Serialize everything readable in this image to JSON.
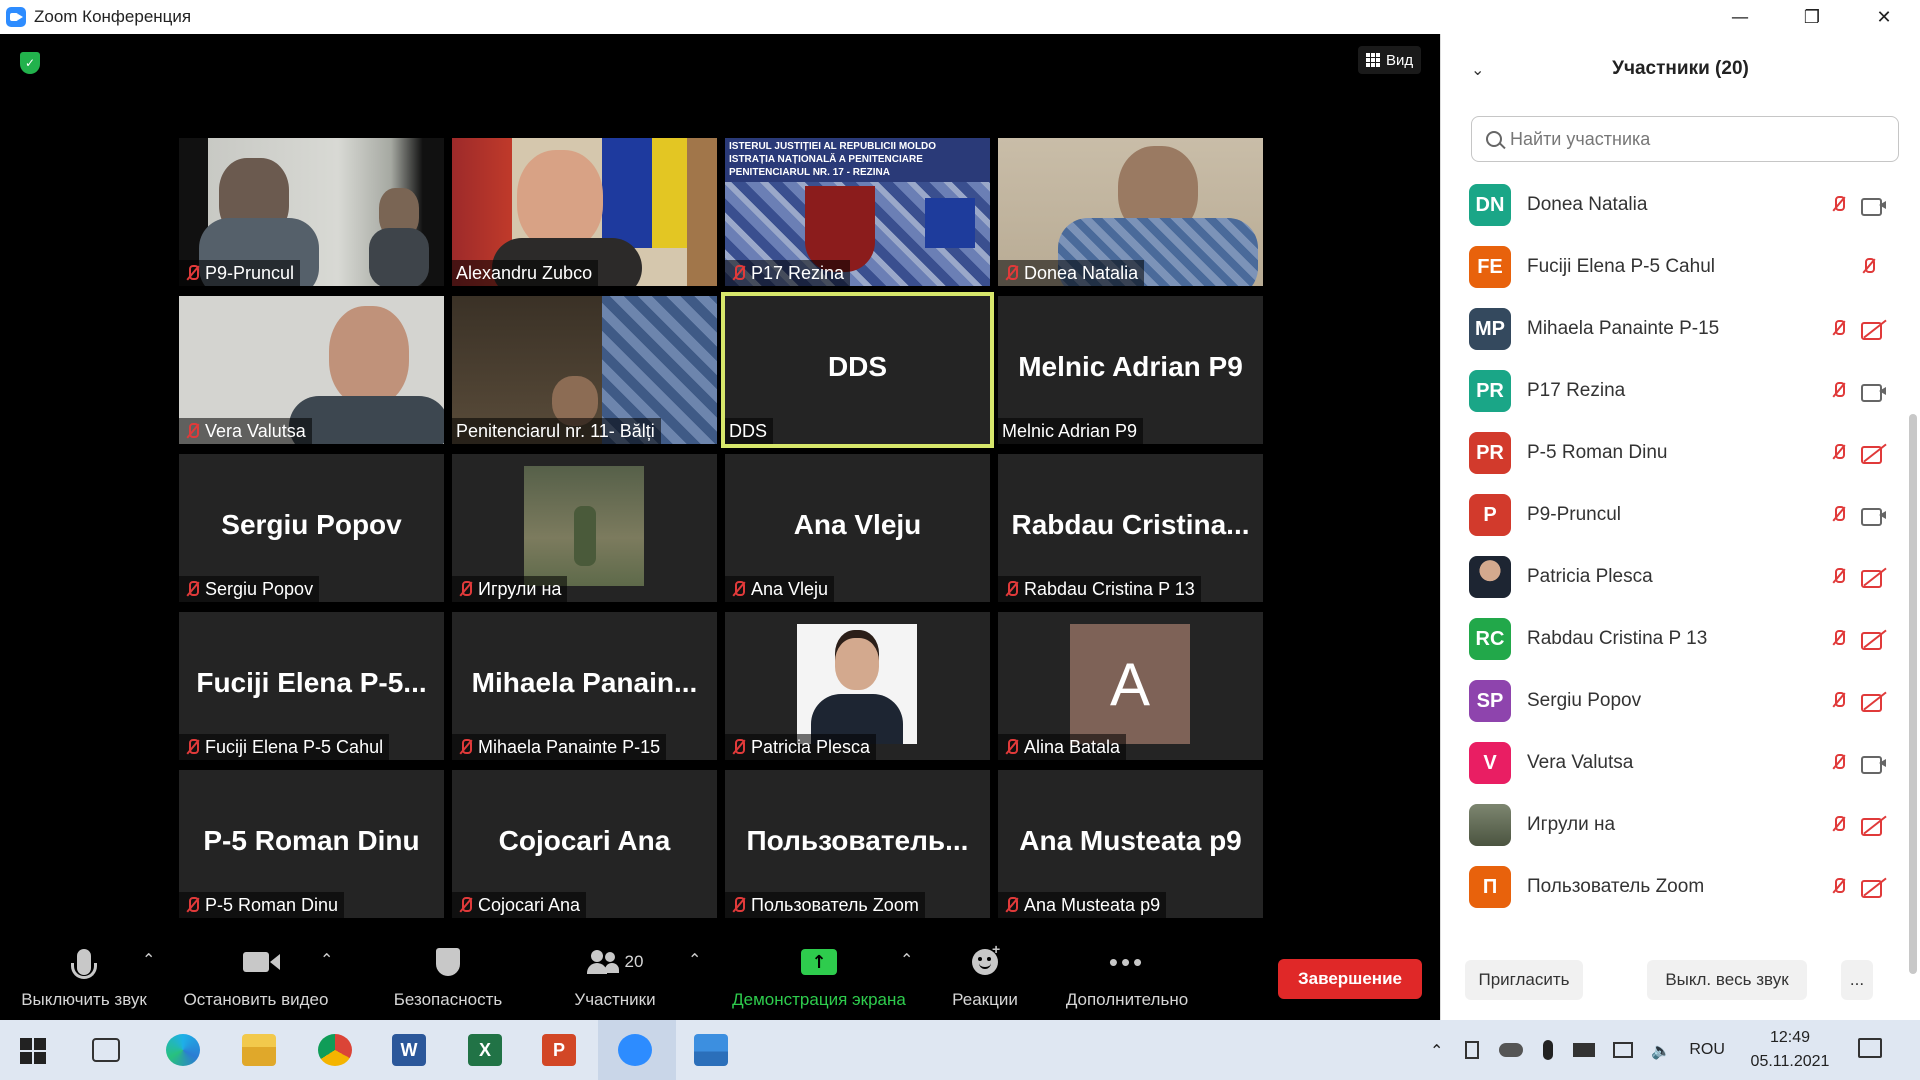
{
  "window": {
    "title": "Zoom Конференция",
    "minimize": "—",
    "restore": "❐",
    "close": "✕"
  },
  "view_button": "Вид",
  "tiles": [
    {
      "display": "",
      "label": "P9-Pruncul",
      "muted": true
    },
    {
      "display": "",
      "label": "Alexandru Zubco",
      "muted": false
    },
    {
      "display": "",
      "label": "P17 Rezina",
      "muted": true,
      "banner": "ISTERUL JUSTIȚIEI AL REPUBLICII MOLDO\nISTRAȚIA NAȚIONALĂ A PENITENCIARE\nPENITENCIARUL NR. 17 - REZINA"
    },
    {
      "display": "",
      "label": "Donea Natalia",
      "muted": true
    },
    {
      "display": "",
      "label": "Vera Valutsa",
      "muted": true
    },
    {
      "display": "",
      "label": "Penitenciarul nr. 11- Bălți",
      "muted": false
    },
    {
      "display": "DDS",
      "label": "DDS",
      "muted": false
    },
    {
      "display": "Melnic Adrian P9",
      "label": "Melnic Adrian P9",
      "muted": false
    },
    {
      "display": "Sergiu Popov",
      "label": "Sergiu Popov",
      "muted": true
    },
    {
      "display": "",
      "label": "Игрули на",
      "muted": true
    },
    {
      "display": "Ana Vleju",
      "label": "Ana Vleju",
      "muted": true
    },
    {
      "display": "Rabdau  Cristina...",
      "label": "Rabdau Cristina P 13",
      "muted": true
    },
    {
      "display": "Fuciji  Elena  P-5...",
      "label": "Fuciji Elena P-5 Cahul",
      "muted": true
    },
    {
      "display": "Mihaela  Panain...",
      "label": "Mihaela Panainte P-15",
      "muted": true
    },
    {
      "display": "",
      "label": "Patricia Plesca",
      "muted": true
    },
    {
      "display": "",
      "label": "Alina Batala",
      "muted": true,
      "initial": "A"
    },
    {
      "display": "P-5 Roman  Dinu",
      "label": "P-5 Roman  Dinu",
      "muted": true
    },
    {
      "display": "Cojocari Ana",
      "label": "Cojocari Ana",
      "muted": true
    },
    {
      "display": "Пользователь...",
      "label": "Пользователь Zoom",
      "muted": true
    },
    {
      "display": "Ana Musteata p9",
      "label": "Ana Musteata p9",
      "muted": true
    }
  ],
  "toolbar": {
    "mute": "Выключить звук",
    "video": "Остановить видео",
    "security": "Безопасность",
    "participants": "Участники",
    "participants_count": "20",
    "share": "Демонстрация экрана",
    "reactions": "Реакции",
    "more": "Дополнительно",
    "end": "Завершение"
  },
  "panel": {
    "title": "Участники (20)",
    "search_placeholder": "Найти участника",
    "invite": "Пригласить",
    "mute_all": "Выкл. весь звук",
    "more": "...",
    "participants": [
      {
        "initials": "DN",
        "name": "Donea Natalia",
        "color": "#1aa687",
        "cam": "on"
      },
      {
        "initials": "FE",
        "name": "Fuciji Elena P-5 Cahul",
        "color": "#e8620c",
        "cam": "none"
      },
      {
        "initials": "MP",
        "name": "Mihaela Panainte P-15",
        "color": "#34495e",
        "cam": "off"
      },
      {
        "initials": "PR",
        "name": "P17 Rezina",
        "color": "#1aa687",
        "cam": "on"
      },
      {
        "initials": "PR",
        "name": "P-5 Roman  Dinu",
        "color": "#d23a2c",
        "cam": "off"
      },
      {
        "initials": "P",
        "name": "P9-Pruncul",
        "color": "#d23a2c",
        "cam": "on"
      },
      {
        "initials": "",
        "name": "Patricia Plesca",
        "color": "#ffffff",
        "cam": "off",
        "photo": true
      },
      {
        "initials": "RC",
        "name": "Rabdau Cristina P 13",
        "color": "#22a84a",
        "cam": "off"
      },
      {
        "initials": "SP",
        "name": "Sergiu Popov",
        "color": "#8e44ad",
        "cam": "off"
      },
      {
        "initials": "V",
        "name": "Vera Valutsa",
        "color": "#e91e63",
        "cam": "on"
      },
      {
        "initials": "",
        "name": "Игрули на",
        "color": "#6b7565",
        "cam": "off",
        "photo": true
      },
      {
        "initials": "П",
        "name": "Пользователь Zoom",
        "color": "#e8620c",
        "cam": "off"
      }
    ]
  },
  "taskbar": {
    "language": "ROU",
    "time": "12:49",
    "date": "05.11.2021"
  }
}
